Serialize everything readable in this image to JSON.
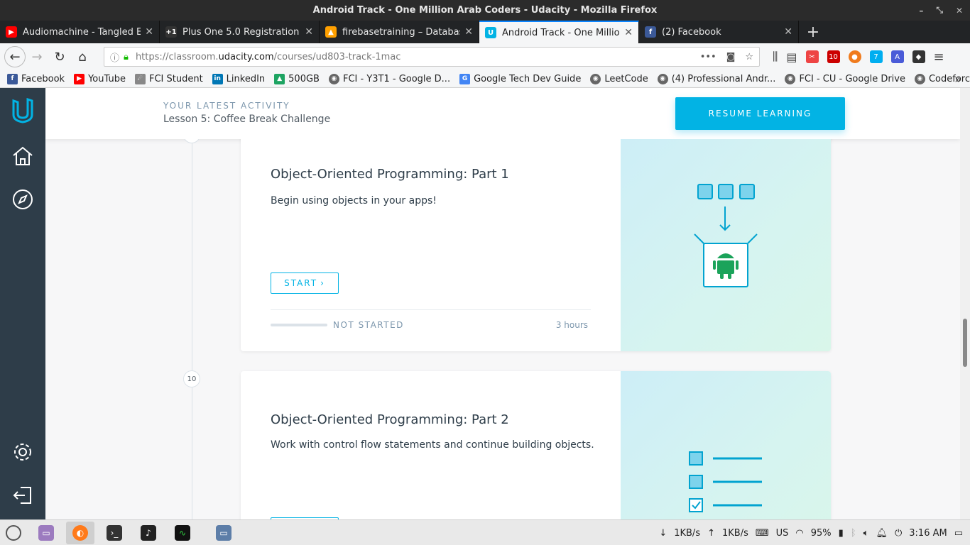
{
  "window": {
    "title": "Android Track - One Million Arab Coders - Udacity - Mozilla Firefox"
  },
  "tabs": [
    {
      "label": "Audiomachine - Tangled Earth",
      "icon": "youtube-icon",
      "color": "#ff0000"
    },
    {
      "label": "Plus One 5.0 Registration",
      "icon": "plus-one-icon",
      "color": "#333333"
    },
    {
      "label": "firebasetraining – Database",
      "icon": "firebase-icon",
      "color": "#ffa000"
    },
    {
      "label": "Android Track - One Million Arab Coders",
      "icon": "udacity-icon",
      "color": "#02b3e4",
      "active": true
    },
    {
      "label": "(2) Facebook",
      "icon": "facebook-icon",
      "color": "#3b5998"
    }
  ],
  "urlbar": {
    "prefix": "https://classroom.",
    "domain": "udacity.com",
    "path": "/courses/ud803-track-1mac"
  },
  "extensions": {
    "badge_abp": "10",
    "badge_ghost": "7"
  },
  "bookmarks": [
    {
      "label": "Facebook",
      "color": "#3b5998",
      "glyph": "f"
    },
    {
      "label": "YouTube",
      "color": "#ff0000",
      "glyph": "▶"
    },
    {
      "label": "FCI Student",
      "color": "#777777",
      "glyph": "☄"
    },
    {
      "label": "LinkedIn",
      "color": "#0077b5",
      "glyph": "in"
    },
    {
      "label": "500GB",
      "color": "#1da462",
      "glyph": "▲"
    },
    {
      "label": "FCI - Y3T1 - Google D...",
      "color": "#666666",
      "glyph": "◉"
    },
    {
      "label": "Google Tech Dev Guide",
      "color": "#4285f4",
      "glyph": "G"
    },
    {
      "label": "LeetCode",
      "color": "#666666",
      "glyph": "◉"
    },
    {
      "label": "(4) Professional Andr...",
      "color": "#666666",
      "glyph": "◉"
    },
    {
      "label": "FCI - CU - Google Drive",
      "color": "#666666",
      "glyph": "◉"
    },
    {
      "label": "Codeforces",
      "color": "#666666",
      "glyph": "◉"
    }
  ],
  "header": {
    "latest_label": "YOUR LATEST ACTIVITY",
    "latest_lesson": "Lesson 5: Coffee Break Challenge",
    "resume_label": "RESUME LEARNING"
  },
  "lessons": [
    {
      "title": "Object-Oriented Programming: Part 1",
      "description": "Begin using objects in your apps!",
      "start_label": "START",
      "status": "NOT STARTED",
      "duration": "3 hours",
      "progress": 0
    },
    {
      "number": "10",
      "title": "Object-Oriented Programming: Part 2",
      "description": "Work with control flow statements and continue building objects."
    }
  ],
  "taskbar": {
    "net_down": "1KB/s",
    "net_up": "1KB/s",
    "keyboard": "US",
    "battery": "95%",
    "time": "3:16 AM"
  }
}
